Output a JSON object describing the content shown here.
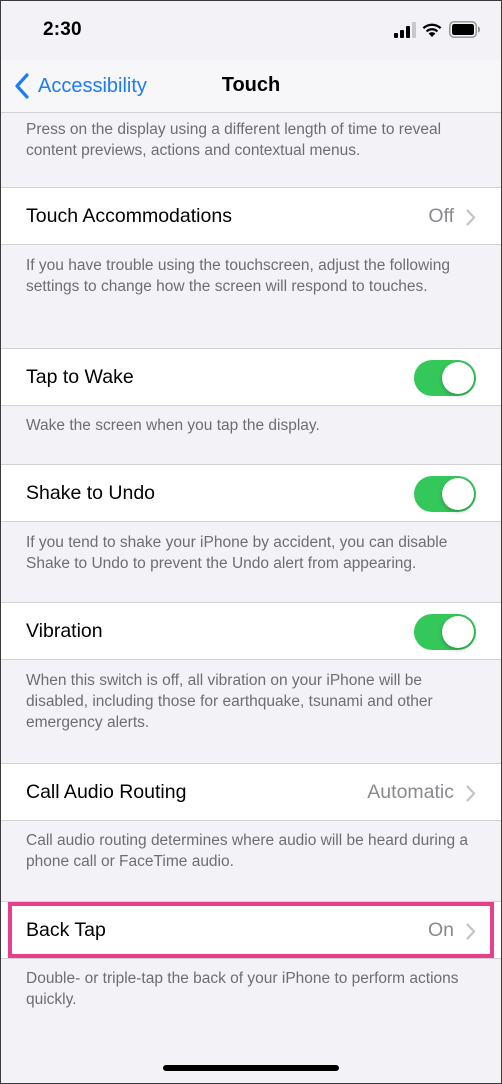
{
  "status_bar": {
    "time": "2:30",
    "icons": [
      "signal-icon",
      "wifi-icon",
      "battery-icon"
    ]
  },
  "nav": {
    "back_label": "Accessibility",
    "title": "Touch",
    "back_icon": "chevron-left-icon"
  },
  "sections": {
    "haptic_footer": "Press on the display using a different length of time to reveal content previews, actions and contextual menus.",
    "touch_accommodations": {
      "label": "Touch Accommodations",
      "value": "Off",
      "footer": "If you have trouble using the touchscreen, adjust the following settings to change how the screen will respond to touches."
    },
    "tap_to_wake": {
      "label": "Tap to Wake",
      "enabled": true,
      "footer": "Wake the screen when you tap the display."
    },
    "shake_to_undo": {
      "label": "Shake to Undo",
      "enabled": true,
      "footer": "If you tend to shake your iPhone by accident, you can disable Shake to Undo to prevent the Undo alert from appearing."
    },
    "vibration": {
      "label": "Vibration",
      "enabled": true,
      "footer": "When this switch is off, all vibration on your iPhone will be disabled, including those for earthquake, tsunami and other emergency alerts."
    },
    "call_audio_routing": {
      "label": "Call Audio Routing",
      "value": "Automatic",
      "footer": "Call audio routing determines where audio will be heard during a phone call or FaceTime audio."
    },
    "back_tap": {
      "label": "Back Tap",
      "value": "On",
      "footer": "Double- or triple-tap the back of your iPhone to perform actions quickly."
    }
  },
  "colors": {
    "accent": "#1b7cf6",
    "toggle_on": "#34c759",
    "highlight": "#e83e8c",
    "background": "#f2f2f7",
    "secondary_text": "#6d6d72"
  }
}
